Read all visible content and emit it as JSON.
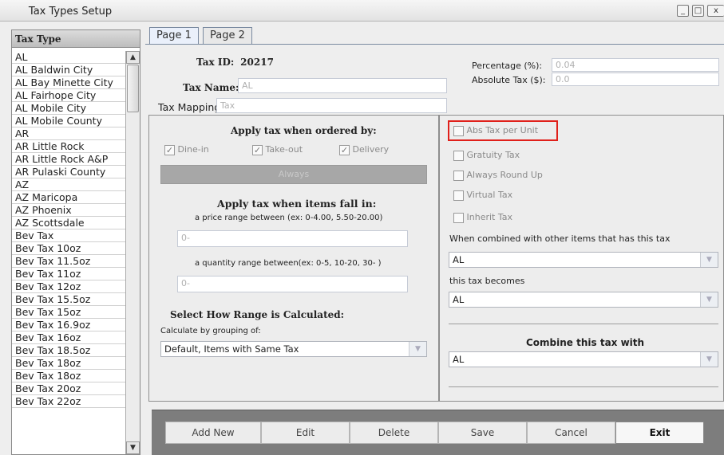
{
  "window": {
    "title": "Tax Types Setup"
  },
  "list": {
    "header": "Tax Type",
    "items": [
      "AL",
      "AL Baldwin City",
      "AL Bay Minette City",
      "AL Fairhope City",
      "AL Mobile City",
      "AL Mobile County",
      "AR",
      "AR Little Rock",
      "AR Little Rock A&P",
      "AR Pulaski County",
      "AZ",
      "AZ Maricopa",
      "AZ Phoenix",
      "AZ Scottsdale",
      "Bev Tax",
      "Bev Tax 10oz",
      "Bev Tax 11.5oz",
      "Bev Tax 11oz",
      "Bev Tax 12oz",
      "Bev Tax 15.5oz",
      "Bev Tax 15oz",
      "Bev Tax 16.9oz",
      "Bev Tax 16oz",
      "Bev Tax 18.5oz",
      "Bev Tax 18oz",
      "Bev Tax 18oz",
      "Bev Tax 20oz",
      "Bev Tax 22oz"
    ]
  },
  "tabs": [
    "Page 1",
    "Page 2"
  ],
  "form": {
    "tax_id_label": "Tax ID:",
    "tax_id_value": "20217",
    "tax_name_label": "Tax Name:",
    "tax_name_value": "AL",
    "tax_mapping_label": "Tax Mapping :",
    "tax_mapping_value": "Tax",
    "percentage_label": "Percentage (%):",
    "percentage_value": "0.04",
    "absolute_label": "Absolute Tax ($):",
    "absolute_value": "0.0"
  },
  "left_section": {
    "apply_ordered_title": "Apply tax when ordered by:",
    "dine_in": "Dine-in",
    "take_out": "Take-out",
    "delivery": "Delivery",
    "always_label": "Always",
    "apply_items_title": "Apply tax when items fall in:",
    "price_range_label": "a price range between (ex: 0-4.00, 5.50-20.00)",
    "price_range_value": "0-",
    "qty_range_label": "a quantity range between(ex: 0-5, 10-20, 30- )",
    "qty_range_value": "0-",
    "select_range_title": "Select How Range is Calculated:",
    "calc_group_label": "Calculate by grouping of:",
    "calc_group_value": "Default, Items with Same Tax"
  },
  "right_section": {
    "abs_tax_per_unit": "Abs Tax per Unit",
    "gratuity_tax": "Gratuity Tax",
    "always_round_up": "Always Round Up",
    "virtual_tax": "Virtual Tax",
    "inherit_tax": "Inherit Tax",
    "combined_label": "When combined with other items that has this tax",
    "combined_value": "AL",
    "becomes_label": "this tax becomes",
    "becomes_value": "AL",
    "combine_with_title": "Combine this tax with",
    "combine_with_value": "AL"
  },
  "buttons": {
    "add_new": "Add New",
    "edit": "Edit",
    "delete": "Delete",
    "save": "Save",
    "cancel": "Cancel",
    "exit": "Exit"
  },
  "colors": {
    "highlight": "#e0201a",
    "accent_tab": "#eaf0fb",
    "button_bar": "#7d7d7d"
  }
}
